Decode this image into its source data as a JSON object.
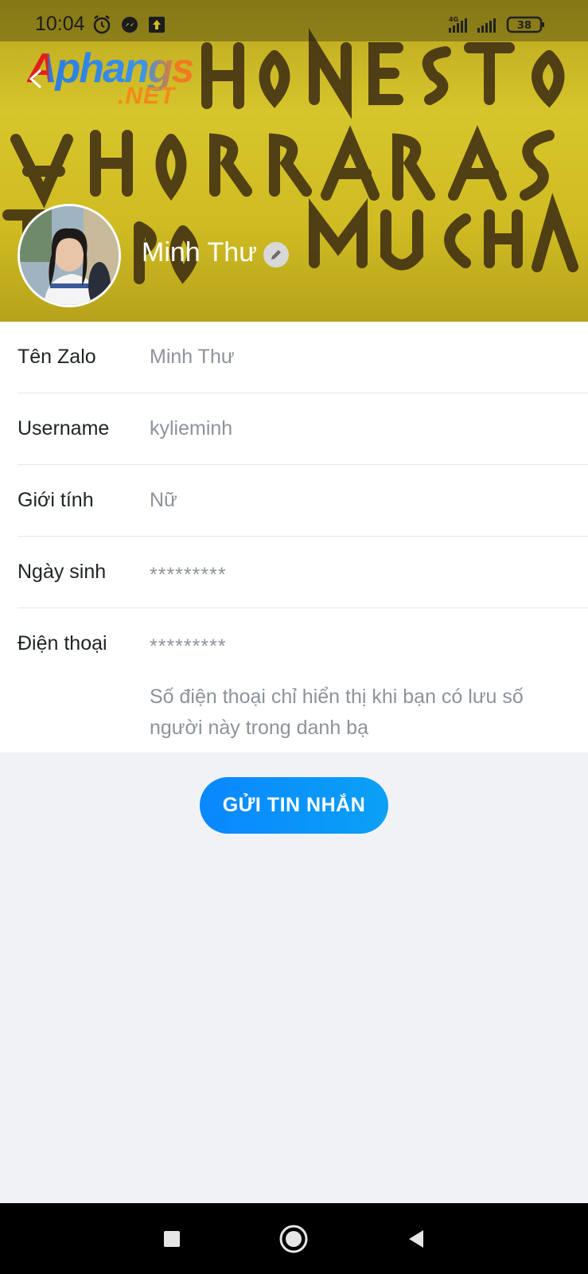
{
  "status_bar": {
    "time": "10:04",
    "network": "4G",
    "battery": "38"
  },
  "watermark": {
    "main": "Aphangs",
    "sub": ".NET"
  },
  "cover": {
    "words": [
      "ERES HONESTO,",
      "E AHORRARÁS",
      "TIEMPO A MUCHAS"
    ]
  },
  "profile": {
    "name": "Minh Thư"
  },
  "info": {
    "rows": [
      {
        "label": "Tên Zalo",
        "value": "Minh Thư"
      },
      {
        "label": "Username",
        "value": "kylieminh"
      },
      {
        "label": "Giới tính",
        "value": "Nữ"
      },
      {
        "label": "Ngày sinh",
        "value": "*********"
      },
      {
        "label": "Điện thoại",
        "value": "*********"
      }
    ],
    "phone_note": "Số điện thoại chỉ hiển thị khi bạn có lưu số người này trong danh bạ"
  },
  "actions": {
    "send_message": "GỬI TIN NHẮN"
  },
  "colors": {
    "accent": "#0a8cff",
    "cover": "#d0bd26",
    "background": "#f1f2f5"
  }
}
